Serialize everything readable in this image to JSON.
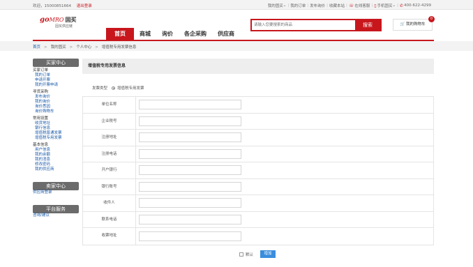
{
  "topbar": {
    "welcome": "欢迎，15000851664",
    "logout": "退出登录",
    "links": [
      "我的固买",
      "我的订单",
      "发布询价",
      "收藏本站",
      "在线客服",
      "手机固买",
      "400-622-4299"
    ]
  },
  "logo": {
    "go": "go",
    "mro": "MRO",
    "cn": "固买",
    "sub": "固买供应链"
  },
  "nav": [
    "首页",
    "商城",
    "询价",
    "各企采购",
    "供应商"
  ],
  "search": {
    "placeholder": "请输入您要搜索的商品",
    "button": "搜索"
  },
  "cart": {
    "label": "我的购物车",
    "count": "0"
  },
  "breadcrumb": {
    "home": "首页",
    "items": [
      "我的固买",
      "个人中心",
      "增值税专用发票信息"
    ]
  },
  "sidebar": {
    "buyer_head": "买家中心",
    "groups": [
      {
        "title": "买家订单",
        "links": [
          "我的订单",
          "申请开票",
          "我的开票申请"
        ]
      },
      {
        "title": "寻货采购",
        "links": [
          "发布询价",
          "我的询价",
          "询价悉因",
          "询价购物车"
        ]
      },
      {
        "title": "常用设置",
        "links": [
          "收货地址",
          "银行信息",
          "增值税普通发票",
          "增值税专用发票"
        ]
      },
      {
        "title": "基本信息",
        "links": [
          "用户信息",
          "我的余额",
          "我的消息",
          "修改密码",
          "我的供应商"
        ]
      }
    ],
    "seller_head": "卖家中心",
    "seller_links": [
      "供应商登录"
    ],
    "platform_head": "平台服务",
    "platform_links": [
      "咨询/建议"
    ]
  },
  "main": {
    "title": "增值税专用发票信息",
    "invoice_type_label": "发票类型",
    "invoice_type_value": "增值税专用发票",
    "fields": [
      {
        "label": "单位名称",
        "value": ""
      },
      {
        "label": "企业税号",
        "value": ""
      },
      {
        "label": "注册地址",
        "value": ""
      },
      {
        "label": "注册电话",
        "value": ""
      },
      {
        "label": "开户银行",
        "value": ""
      },
      {
        "label": "银行账号",
        "value": ""
      },
      {
        "label": "收件人",
        "value": ""
      },
      {
        "label": "联系电话",
        "value": ""
      },
      {
        "label": "收票地址",
        "value": ""
      }
    ],
    "default_label": "默认",
    "add_button": "增加"
  },
  "colors": {
    "brand_red": "#c8161d",
    "link_blue": "#1a5aa8",
    "button_blue": "#3a8ede"
  }
}
